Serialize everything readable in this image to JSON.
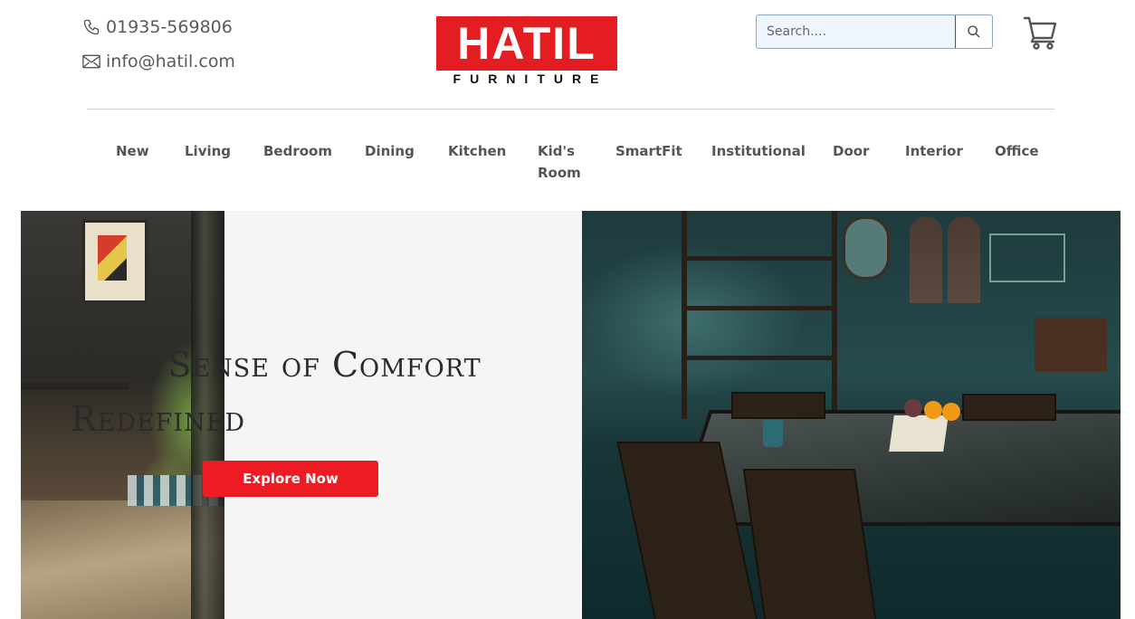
{
  "header": {
    "phone": "01935-569806",
    "email": "info@hatil.com",
    "logo_main": "HATIL",
    "logo_sub": "FURNITURE",
    "search_placeholder": "Search...."
  },
  "nav": {
    "items": [
      {
        "label": "New"
      },
      {
        "label": "Living"
      },
      {
        "label": "Bedroom"
      },
      {
        "label": "Dining"
      },
      {
        "label": "Kitchen"
      },
      {
        "label_line1": "Kid's",
        "label_line2": "Room"
      },
      {
        "label": "SmartFit"
      },
      {
        "label": "Institutional"
      },
      {
        "label": "Door"
      },
      {
        "label": "Interior"
      },
      {
        "label": "Office"
      }
    ]
  },
  "hero": {
    "title_line1": "Your Sense of Comfort",
    "title_line2": "Redefined",
    "cta_label": "Explore Now"
  },
  "colors": {
    "brand_red": "#e41d23",
    "button_red": "#ed1c24",
    "nav_text": "#555555"
  },
  "icons": [
    "phone-icon",
    "mail-icon",
    "search-icon",
    "cart-icon"
  ]
}
